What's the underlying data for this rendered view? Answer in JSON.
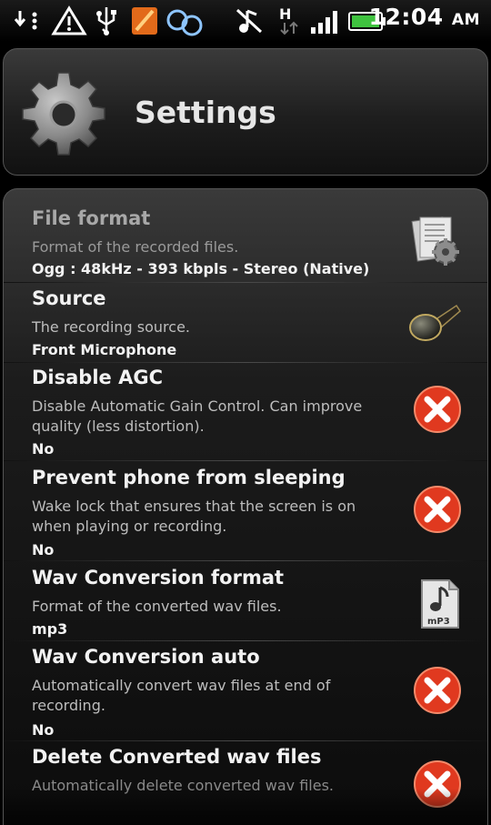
{
  "status_bar": {
    "icons": [
      "download-icon",
      "warning-icon",
      "usb-icon",
      "app-icon",
      "glasses-icon",
      "no-sound-icon",
      "hspa-icon",
      "signal-icon",
      "battery-icon"
    ],
    "time": "12:04",
    "ampm": "AM"
  },
  "header": {
    "title": "Settings",
    "icon": "gear-icon"
  },
  "settings": [
    {
      "title": "File format",
      "description": "Format of the recorded files.",
      "value": "Ogg : 48kHz - 393 kbpls - Stereo (Native)",
      "icon": "file-settings-icon"
    },
    {
      "title": "Source",
      "description": "The recording source.",
      "value": "Front Microphone",
      "icon": "microphone-icon"
    },
    {
      "title": "Disable AGC",
      "description": "Disable Automatic Gain Control. Can improve quality (less distortion).",
      "value": "No",
      "icon": "disabled-icon"
    },
    {
      "title": "Prevent phone from sleeping",
      "description": "Wake lock that ensures that the screen is on when playing or recording.",
      "value": "No",
      "icon": "disabled-icon"
    },
    {
      "title": "Wav Conversion format",
      "description": "Format of the converted wav files.",
      "value": "mp3",
      "icon": "mp3-file-icon"
    },
    {
      "title": "Wav Conversion auto",
      "description": "Automatically convert wav files at end of recording.",
      "value": "No",
      "icon": "disabled-icon"
    },
    {
      "title": "Delete Converted wav files",
      "description": "Automatically delete converted wav files.",
      "value": "",
      "icon": "disabled-icon"
    }
  ],
  "colors": {
    "accent_red": "#e0391f",
    "text_primary": "#f2f2f2",
    "text_secondary": "#bdbdbd"
  }
}
